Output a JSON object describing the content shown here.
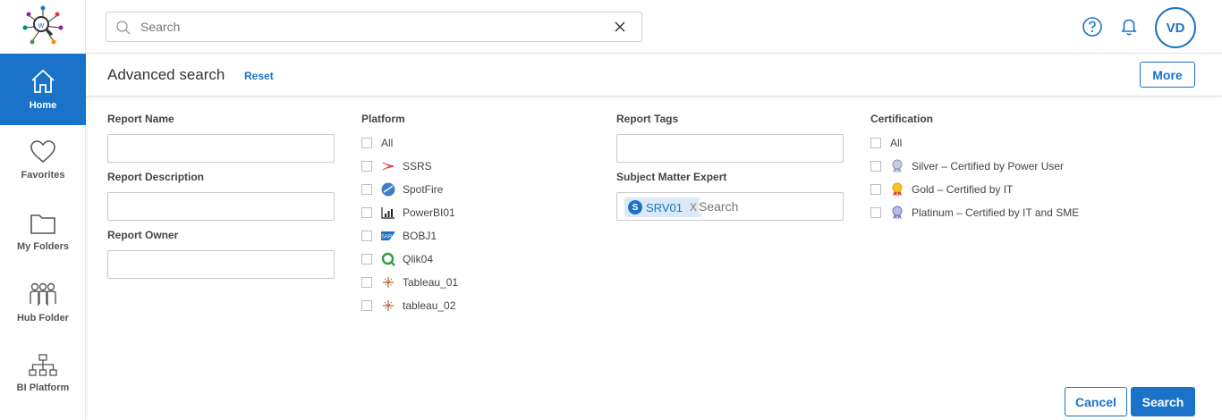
{
  "colors": {
    "accent": "#1a73c8"
  },
  "sidebar": {
    "items": [
      {
        "label": "Home",
        "icon": "home-icon",
        "active": true
      },
      {
        "label": "Favorites",
        "icon": "heart-icon"
      },
      {
        "label": "My Folders",
        "icon": "folder-icon"
      },
      {
        "label": "Hub Folder",
        "icon": "people-icon"
      },
      {
        "label": "BI Platform",
        "icon": "hierarchy-icon"
      }
    ]
  },
  "topbar": {
    "search_placeholder": "Search",
    "avatar_initials": "VD"
  },
  "subheader": {
    "title": "Advanced search",
    "reset_label": "Reset",
    "more_label": "More"
  },
  "form": {
    "report_name_label": "Report Name",
    "report_description_label": "Report Description",
    "report_owner_label": "Report Owner",
    "platform_label": "Platform",
    "platforms": [
      {
        "label": "All",
        "icon": ""
      },
      {
        "label": "SSRS",
        "icon": "ssrs-icon"
      },
      {
        "label": "SpotFire",
        "icon": "spotfire-icon"
      },
      {
        "label": "PowerBI01",
        "icon": "powerbi-icon"
      },
      {
        "label": "BOBJ1",
        "icon": "sap-icon"
      },
      {
        "label": "Qlik04",
        "icon": "qlik-icon"
      },
      {
        "label": "Tableau_01",
        "icon": "tableau-icon"
      },
      {
        "label": "tableau_02",
        "icon": "tableau-icon"
      }
    ],
    "report_tags_label": "Report Tags",
    "sme_label": "Subject Matter Expert",
    "sme_chip": {
      "initial": "S",
      "value": "SRV01",
      "remove": "X"
    },
    "sme_placeholder": "Search",
    "certification_label": "Certification",
    "certifications": [
      {
        "label": "All",
        "icon": ""
      },
      {
        "label": "Silver – Certified by Power User",
        "icon": "silver-badge-icon"
      },
      {
        "label": "Gold – Certified by IT",
        "icon": "gold-badge-icon"
      },
      {
        "label": "Platinum – Certified by IT and SME",
        "icon": "platinum-badge-icon"
      }
    ]
  },
  "actions": {
    "cancel_label": "Cancel",
    "search_label": "Search"
  }
}
